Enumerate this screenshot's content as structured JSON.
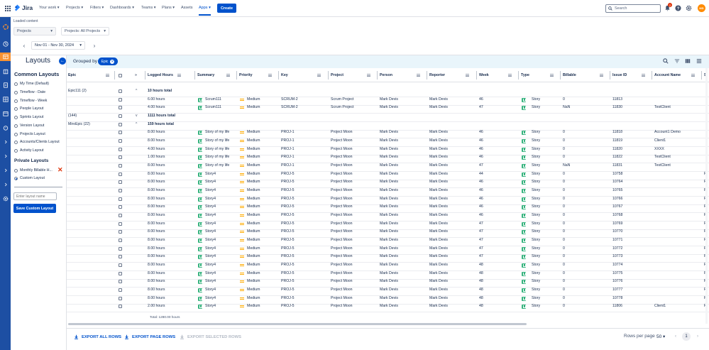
{
  "brand": {
    "name": "Jira"
  },
  "topnav": {
    "items": [
      "Your work",
      "Projects",
      "Filters",
      "Dashboards",
      "Teams",
      "Plans",
      "Assets",
      "Apps"
    ],
    "active": "Apps",
    "create_label": "Create",
    "search_placeholder": "Search",
    "notification_count": "2",
    "avatar_initials": "MD"
  },
  "filters": {
    "loaded_label": "Loaded content",
    "projects_select": "Projects",
    "projects_value": "Projects: All Projects",
    "date_range": "Nov 01 - Nov 30, 2024"
  },
  "layouts": {
    "title": "Layouts",
    "common_title": "Common Layouts",
    "common": [
      "My Time (Default)",
      "Timeflow - Date",
      "Timeflow - Week",
      "People Layout",
      "Sprints Layout",
      "Version Layout",
      "Projects Layout",
      "Accounts/Clients Layout",
      "Activity Layout"
    ],
    "private_title": "Private Layouts",
    "private": [
      "Monthly Billable H...",
      "Custom Layout"
    ],
    "input_placeholder": "Enter layout name",
    "save_label": "Save Custom Layout"
  },
  "grouping": {
    "label": "Grouped by",
    "chip": "Epic"
  },
  "table": {
    "columns": {
      "epic": "Epic",
      "logged": "Logged Hours",
      "summary": "Summary",
      "priority": "Priority",
      "key": "Key",
      "project": "Project",
      "person": "Person",
      "reporter": "Reporter",
      "week": "Week",
      "type": "Type",
      "billable": "Billable",
      "issue_id": "Issue ID",
      "account": "Account Name",
      "extra": "S"
    },
    "rows": [
      {
        "epic": "Epic111 (2)",
        "group": true,
        "caret": "^",
        "logged": "10 hours total"
      },
      {
        "logged": "6.00 hours",
        "summary": "Scrum111",
        "priority": "Medium",
        "key": "SCRUM-2",
        "project": "Scrum Project",
        "person": "Mark Devis",
        "reporter": "Mark Devis",
        "week": "46",
        "type": "Story",
        "billable": "0",
        "issue_id": "11813",
        "account": "",
        "extra": ""
      },
      {
        "logged": "4.00 hours",
        "summary": "Scrum111",
        "priority": "Medium",
        "key": "SCRUM-2",
        "project": "Scrum Project",
        "person": "Mark Devis",
        "reporter": "Mark Devis",
        "week": "47",
        "type": "Story",
        "billable": "NaN",
        "issue_id": "11830",
        "account": "TestClient",
        "extra": ""
      },
      {
        "epic": "(144)",
        "group": true,
        "caret": "v",
        "logged": "1111 hours total"
      },
      {
        "epic": "MiroEpic (22)",
        "group": true,
        "caret": "^",
        "logged": "159 hours total"
      },
      {
        "logged": "8.00 hours",
        "summary": "Story of my life",
        "priority": "Medium",
        "key": "PROJ-1",
        "project": "Project Moon",
        "person": "Mark Devis",
        "reporter": "Mark Devis",
        "week": "46",
        "type": "Story",
        "billable": "0",
        "issue_id": "11818",
        "account": "Account1 Demo",
        "extra": ""
      },
      {
        "logged": "8.00 hours",
        "summary": "Story of my life",
        "priority": "Medium",
        "key": "PROJ-1",
        "project": "Project Moon",
        "person": "Mark Devis",
        "reporter": "Mark Devis",
        "week": "46",
        "type": "Story",
        "billable": "0",
        "issue_id": "11819",
        "account": "Client1",
        "extra": ""
      },
      {
        "logged": "4.00 hours",
        "summary": "Story of my life",
        "priority": "Medium",
        "key": "PROJ-1",
        "project": "Project Moon",
        "person": "Mark Devis",
        "reporter": "Mark Devis",
        "week": "46",
        "type": "Story",
        "billable": "0",
        "issue_id": "11820",
        "account": "XXXX",
        "extra": ""
      },
      {
        "logged": "1.00 hours",
        "summary": "Story of my life",
        "priority": "Medium",
        "key": "PROJ-1",
        "project": "Project Moon",
        "person": "Mark Devis",
        "reporter": "Mark Devis",
        "week": "46",
        "type": "Story",
        "billable": "0",
        "issue_id": "11822",
        "account": "TestClient",
        "extra": ""
      },
      {
        "logged": "8.00 hours",
        "summary": "Story of my life",
        "priority": "Medium",
        "key": "PROJ-1",
        "project": "Project Moon",
        "person": "Mark Devis",
        "reporter": "Mark Devis",
        "week": "47",
        "type": "Story",
        "billable": "NaN",
        "issue_id": "11831",
        "account": "TestClient",
        "extra": ""
      },
      {
        "logged": "8.00 hours",
        "summary": "Story4",
        "priority": "Medium",
        "key": "PROJ-5",
        "project": "Project Moon",
        "person": "Mark Devis",
        "reporter": "Mark Devis",
        "week": "44",
        "type": "Story",
        "billable": "0",
        "issue_id": "10758",
        "account": "",
        "extra": "P"
      },
      {
        "logged": "8.00 hours",
        "summary": "Story4",
        "priority": "Medium",
        "key": "PROJ-5",
        "project": "Project Moon",
        "person": "Mark Devis",
        "reporter": "Mark Devis",
        "week": "46",
        "type": "Story",
        "billable": "0",
        "issue_id": "10764",
        "account": "",
        "extra": "P"
      },
      {
        "logged": "8.00 hours",
        "summary": "Story4",
        "priority": "Medium",
        "key": "PROJ-5",
        "project": "Project Moon",
        "person": "Mark Devis",
        "reporter": "Mark Devis",
        "week": "46",
        "type": "Story",
        "billable": "0",
        "issue_id": "10765",
        "account": "",
        "extra": "P"
      },
      {
        "logged": "8.00 hours",
        "summary": "Story4",
        "priority": "Medium",
        "key": "PROJ-5",
        "project": "Project Moon",
        "person": "Mark Devis",
        "reporter": "Mark Devis",
        "week": "46",
        "type": "Story",
        "billable": "0",
        "issue_id": "10766",
        "account": "",
        "extra": "P"
      },
      {
        "logged": "8.00 hours",
        "summary": "Story4",
        "priority": "Medium",
        "key": "PROJ-5",
        "project": "Project Moon",
        "person": "Mark Devis",
        "reporter": "Mark Devis",
        "week": "46",
        "type": "Story",
        "billable": "0",
        "issue_id": "10767",
        "account": "",
        "extra": "P"
      },
      {
        "logged": "8.00 hours",
        "summary": "Story4",
        "priority": "Medium",
        "key": "PROJ-5",
        "project": "Project Moon",
        "person": "Mark Devis",
        "reporter": "Mark Devis",
        "week": "46",
        "type": "Story",
        "billable": "0",
        "issue_id": "10768",
        "account": "",
        "extra": "P"
      },
      {
        "logged": "8.00 hours",
        "summary": "Story4",
        "priority": "Medium",
        "key": "PROJ-5",
        "project": "Project Moon",
        "person": "Mark Devis",
        "reporter": "Mark Devis",
        "week": "47",
        "type": "Story",
        "billable": "0",
        "issue_id": "10769",
        "account": "",
        "extra": "P"
      },
      {
        "logged": "8.00 hours",
        "summary": "Story4",
        "priority": "Medium",
        "key": "PROJ-5",
        "project": "Project Moon",
        "person": "Mark Devis",
        "reporter": "Mark Devis",
        "week": "47",
        "type": "Story",
        "billable": "0",
        "issue_id": "10770",
        "account": "",
        "extra": "P"
      },
      {
        "logged": "8.00 hours",
        "summary": "Story4",
        "priority": "Medium",
        "key": "PROJ-5",
        "project": "Project Moon",
        "person": "Mark Devis",
        "reporter": "Mark Devis",
        "week": "47",
        "type": "Story",
        "billable": "0",
        "issue_id": "10771",
        "account": "",
        "extra": "P"
      },
      {
        "logged": "8.00 hours",
        "summary": "Story4",
        "priority": "Medium",
        "key": "PROJ-5",
        "project": "Project Moon",
        "person": "Mark Devis",
        "reporter": "Mark Devis",
        "week": "47",
        "type": "Story",
        "billable": "0",
        "issue_id": "10772",
        "account": "",
        "extra": "P"
      },
      {
        "logged": "8.00 hours",
        "summary": "Story4",
        "priority": "Medium",
        "key": "PROJ-5",
        "project": "Project Moon",
        "person": "Mark Devis",
        "reporter": "Mark Devis",
        "week": "47",
        "type": "Story",
        "billable": "0",
        "issue_id": "10773",
        "account": "",
        "extra": "P"
      },
      {
        "logged": "8.00 hours",
        "summary": "Story4",
        "priority": "Medium",
        "key": "PROJ-5",
        "project": "Project Moon",
        "person": "Mark Devis",
        "reporter": "Mark Devis",
        "week": "48",
        "type": "Story",
        "billable": "0",
        "issue_id": "10774",
        "account": "",
        "extra": "P"
      },
      {
        "logged": "8.00 hours",
        "summary": "Story4",
        "priority": "Medium",
        "key": "PROJ-5",
        "project": "Project Moon",
        "person": "Mark Devis",
        "reporter": "Mark Devis",
        "week": "48",
        "type": "Story",
        "billable": "0",
        "issue_id": "10775",
        "account": "",
        "extra": "P"
      },
      {
        "logged": "8.00 hours",
        "summary": "Story4",
        "priority": "Medium",
        "key": "PROJ-5",
        "project": "Project Moon",
        "person": "Mark Devis",
        "reporter": "Mark Devis",
        "week": "48",
        "type": "Story",
        "billable": "0",
        "issue_id": "10776",
        "account": "",
        "extra": "P"
      },
      {
        "logged": "8.00 hours",
        "summary": "Story4",
        "priority": "Medium",
        "key": "PROJ-5",
        "project": "Project Moon",
        "person": "Mark Devis",
        "reporter": "Mark Devis",
        "week": "48",
        "type": "Story",
        "billable": "0",
        "issue_id": "10777",
        "account": "",
        "extra": "P"
      },
      {
        "logged": "8.00 hours",
        "summary": "Story4",
        "priority": "Medium",
        "key": "PROJ-5",
        "project": "Project Moon",
        "person": "Mark Devis",
        "reporter": "Mark Devis",
        "week": "48",
        "type": "Story",
        "billable": "0",
        "issue_id": "10778",
        "account": "",
        "extra": "P"
      },
      {
        "logged": "2.00 hours",
        "summary": "Story4",
        "priority": "Medium",
        "key": "PROJ-5",
        "project": "Project Moon",
        "person": "Mark Devis",
        "reporter": "Mark Devis",
        "week": "48",
        "type": "Story",
        "billable": "0",
        "issue_id": "11806",
        "account": "Client1",
        "extra": "P"
      }
    ],
    "total": "Total: 1280.00 hours"
  },
  "footer": {
    "export_all": "EXPORT ALL ROWS",
    "export_page": "EXPORT PAGE ROWS",
    "export_selected": "EXPORT SELECTED ROWS",
    "rows_per_page_label": "Rows per page",
    "rows_per_page_value": "50",
    "current_page": "1"
  },
  "colors": {
    "brand_blue": "#0052cc",
    "rail": "#1d4fa3",
    "accent_orange": "#f79232",
    "story_green": "#36b37e",
    "priority_medium": "#ffab00",
    "danger": "#de350b"
  }
}
